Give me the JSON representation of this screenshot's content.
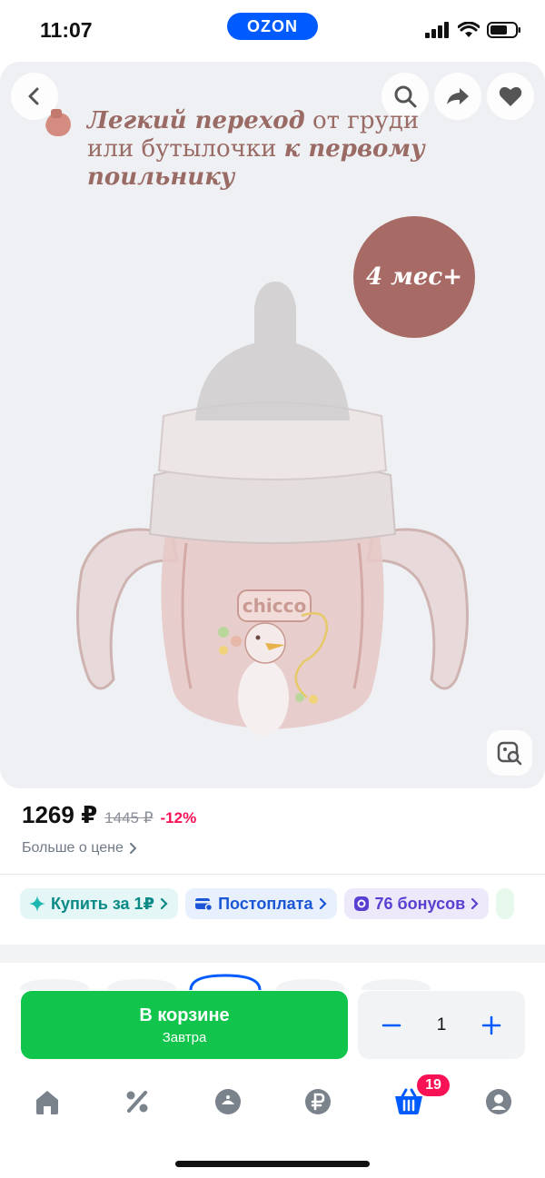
{
  "status_bar": {
    "time": "11:07",
    "app_logo": "OZON"
  },
  "gallery": {
    "headline_bold_1": "Легкий переход",
    "headline_plain_1": " от груди или бутылочки ",
    "headline_bold_2": "к первому поильнику",
    "age_badge": "4 мес+",
    "brand_on_product": "chicco",
    "icons": [
      "back-icon",
      "search-icon",
      "share-icon",
      "heart-icon",
      "image-search-icon"
    ]
  },
  "price": {
    "current": "1269 ₽",
    "old": "1445 ₽",
    "discount": "-12%",
    "more_link": "Больше о цене"
  },
  "chips": {
    "buy_for_1": "Купить за 1₽",
    "postpay": "Постоплата",
    "bonuses": "76 бонусов"
  },
  "cart": {
    "button_title": "В корзине",
    "button_subtitle": "Завтра",
    "quantity": "1"
  },
  "bottom_nav": {
    "items": [
      "home-icon",
      "percent-icon",
      "fresh-icon",
      "ruble-icon",
      "cart-icon",
      "profile-icon"
    ],
    "cart_badge": "19"
  },
  "colors": {
    "ozon_blue": "#005bff",
    "cart_green": "#10c44c",
    "discount_pink": "#f91155",
    "promo_rose": "#a86a64"
  }
}
